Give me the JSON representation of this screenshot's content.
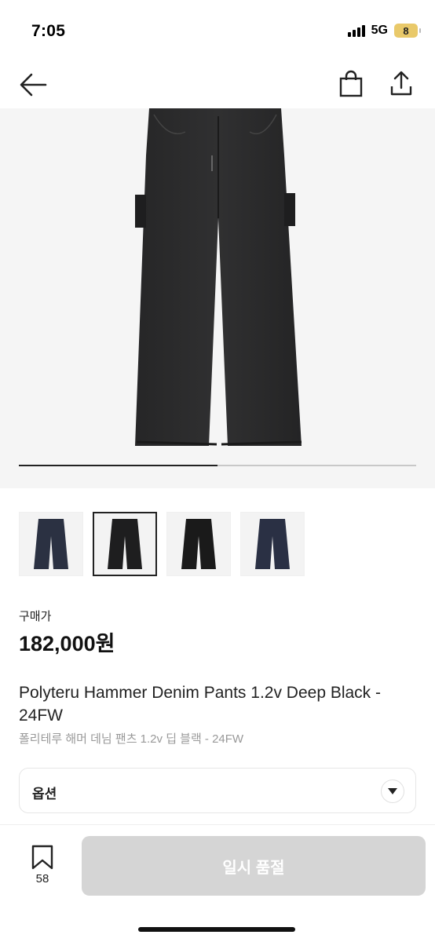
{
  "status_bar": {
    "time": "7:05",
    "network": "5G",
    "battery": "8"
  },
  "nav": {
    "icons": [
      "back-arrow-icon",
      "shopping-bag-icon",
      "share-icon"
    ]
  },
  "gallery": {
    "progress_fraction": 0.5,
    "thumbnail_count": 4,
    "selected_index": 1,
    "thumbnail_colors": [
      "#2b3142",
      "#1e1e1f",
      "#1a1a1a",
      "#2a3044"
    ]
  },
  "price": {
    "label": "구매가",
    "value": "182,000원"
  },
  "product": {
    "title": "Polyteru Hammer Denim Pants 1.2v Deep Black - 24FW",
    "subtitle": "폴리테루 해머 데님 팬츠 1.2v 딥 블랙 - 24FW"
  },
  "options": {
    "label": "옵션"
  },
  "bottom_bar": {
    "bookmark_count": "58",
    "soldout_label": "일시 품절"
  }
}
